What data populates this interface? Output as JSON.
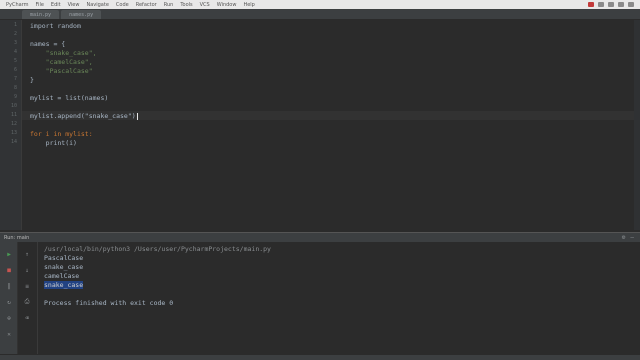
{
  "menubar": {
    "items": [
      "PyCharm",
      "File",
      "Edit",
      "View",
      "Navigate",
      "Code",
      "Refactor",
      "Run",
      "Tools",
      "VCS",
      "Window",
      "Help"
    ]
  },
  "tabs": [
    "main.py",
    "names.py"
  ],
  "editor": {
    "lines": [
      {
        "n": "1",
        "text": "import random"
      },
      {
        "n": "2",
        "text": ""
      },
      {
        "n": "3",
        "text": "names = {"
      },
      {
        "n": "4",
        "text": "    \"snake_case\","
      },
      {
        "n": "5",
        "text": "    \"camelCase\","
      },
      {
        "n": "6",
        "text": "    \"PascalCase\""
      },
      {
        "n": "7",
        "text": "}"
      },
      {
        "n": "8",
        "text": ""
      },
      {
        "n": "9",
        "text": "mylist = list(names)"
      },
      {
        "n": "10",
        "text": ""
      },
      {
        "n": "11",
        "text": "mylist.append(\"snake_case\")"
      },
      {
        "n": "12",
        "text": ""
      },
      {
        "n": "13",
        "text": "for i in mylist:"
      },
      {
        "n": "14",
        "text": "    print(i)"
      }
    ]
  },
  "run": {
    "header_label": "Run: main",
    "console_lines": [
      "/usr/local/bin/python3 /Users/user/PycharmProjects/main.py",
      "PascalCase",
      "snake_case",
      "camelCase",
      "snake_case",
      "",
      "Process finished with exit code 0"
    ]
  },
  "colors": {
    "keyword": "#cc7832",
    "string": "#6a8759",
    "background": "#2b2b2b",
    "selection": "#214283"
  }
}
